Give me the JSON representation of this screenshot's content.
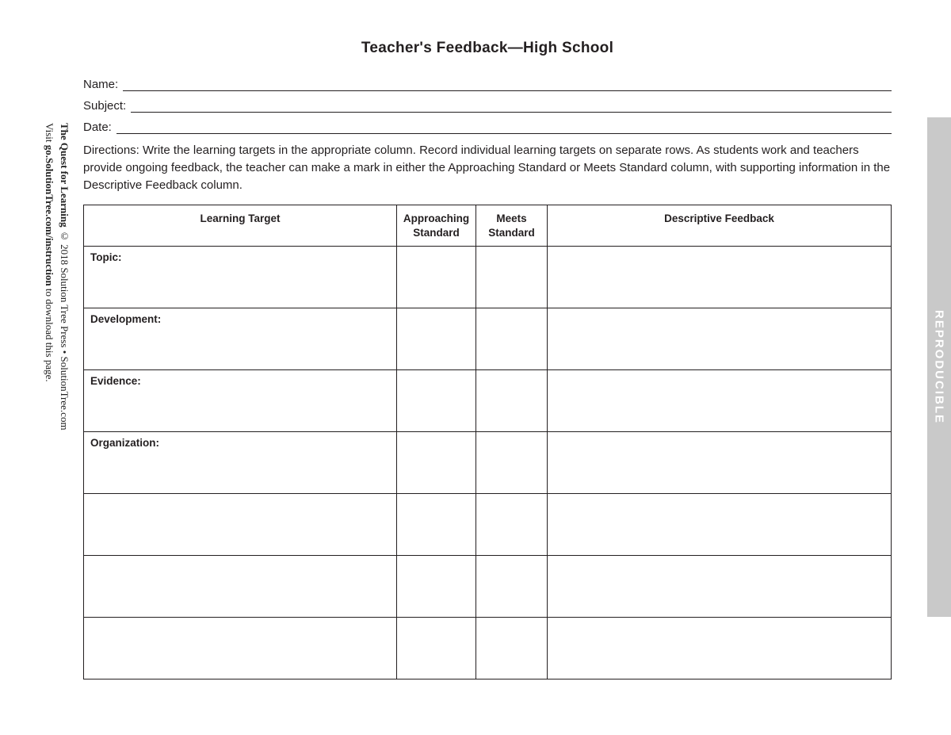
{
  "title": "Teacher's Feedback—High School",
  "fields": {
    "name_label": "Name:",
    "subject_label": "Subject:",
    "date_label": "Date:"
  },
  "directions": "Directions: Write the learning targets in the appropriate column. Record individual learning targets on separate rows. As students work and teachers provide ongoing feedback, the teacher can make a mark in either the Approaching Standard or Meets Standard column, with supporting information in the Descriptive Feedback column.",
  "table": {
    "headers": {
      "target": "Learning Target",
      "approaching": "Approaching Standard",
      "meets": "Meets Standard",
      "descriptive": "Descriptive Feedback"
    },
    "rows": [
      {
        "label": "Topic:"
      },
      {
        "label": "Development:"
      },
      {
        "label": "Evidence:"
      },
      {
        "label": "Organization:"
      },
      {
        "label": ""
      },
      {
        "label": ""
      },
      {
        "label": ""
      }
    ]
  },
  "side_tab": "REPRODUCIBLE",
  "credit": {
    "line1_bold": "The Quest for Learning",
    "line1_rest": " © 2018 Solution Tree Press • SolutionTree.com",
    "line2_pre": "Visit ",
    "line2_bold": "go.SolutionTree.com/instruction",
    "line2_post": " to download this page."
  }
}
